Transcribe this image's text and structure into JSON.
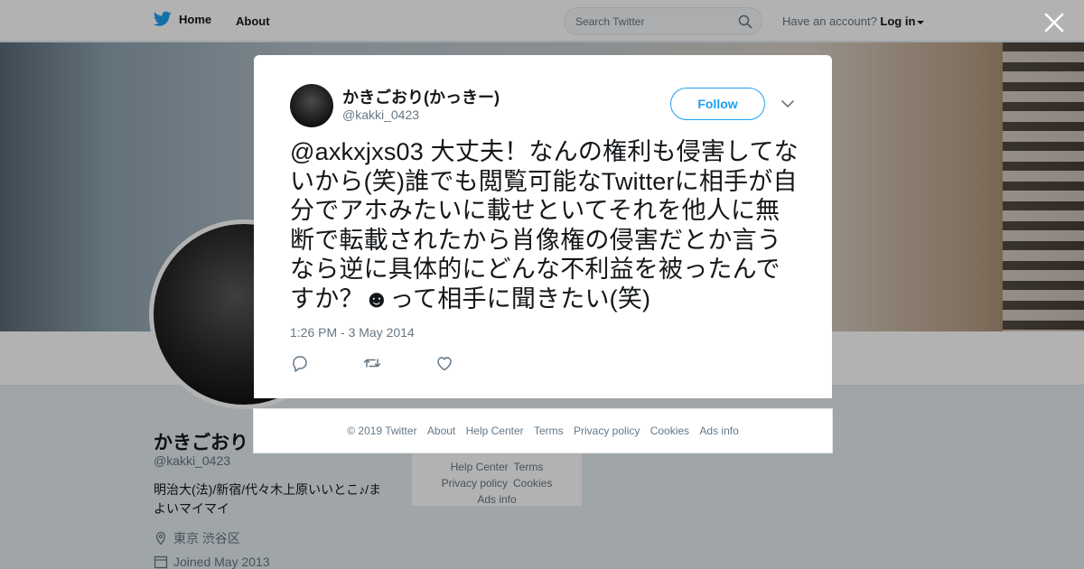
{
  "topbar": {
    "home_label": "Home",
    "about_label": "About",
    "search_placeholder": "Search Twitter",
    "account_text": "Have an account?",
    "login_label": "Log in"
  },
  "profile": {
    "name": "かきごおり",
    "handle": "@kakki_0423",
    "bio": "明治大(法)/新宿/代々木上原いいとこ♪/まよいマイマイ",
    "location": "東京 渋谷区",
    "joined": "Joined May 2013"
  },
  "bg_footer": {
    "links": [
      "Help Center",
      "Terms",
      "Privacy policy",
      "Cookies",
      "Ads info"
    ]
  },
  "tweet": {
    "author_name": "かきごおり(かっきー)",
    "author_handle": "@kakki_0423",
    "follow_label": "Follow",
    "text": "@axkxjxs03 大丈夫！なんの権利も侵害してないから(笑)誰でも閲覧可能なTwitterに相手が自分でアホみたいに載せといてそれを他人に無断で転載されたから肖像権の侵害だとか言うなら逆に具体的にどんな不利益を被ったんですか？☻って相手に聞きたい(笑)",
    "timestamp": "1:26 PM - 3 May 2014"
  },
  "footer": {
    "copyright": "© 2019 Twitter",
    "about": "About",
    "help": "Help Center",
    "terms": "Terms",
    "privacy": "Privacy policy",
    "cookies": "Cookies",
    "ads": "Ads info"
  },
  "colors": {
    "accent": "#1da1f2",
    "secondary_text": "#657786",
    "primary_text": "#14171a"
  },
  "icons": [
    "twitter-bird-icon",
    "search-icon",
    "close-icon",
    "chevron-down-icon",
    "reply-icon",
    "retweet-icon",
    "like-icon",
    "location-icon",
    "calendar-icon"
  ]
}
